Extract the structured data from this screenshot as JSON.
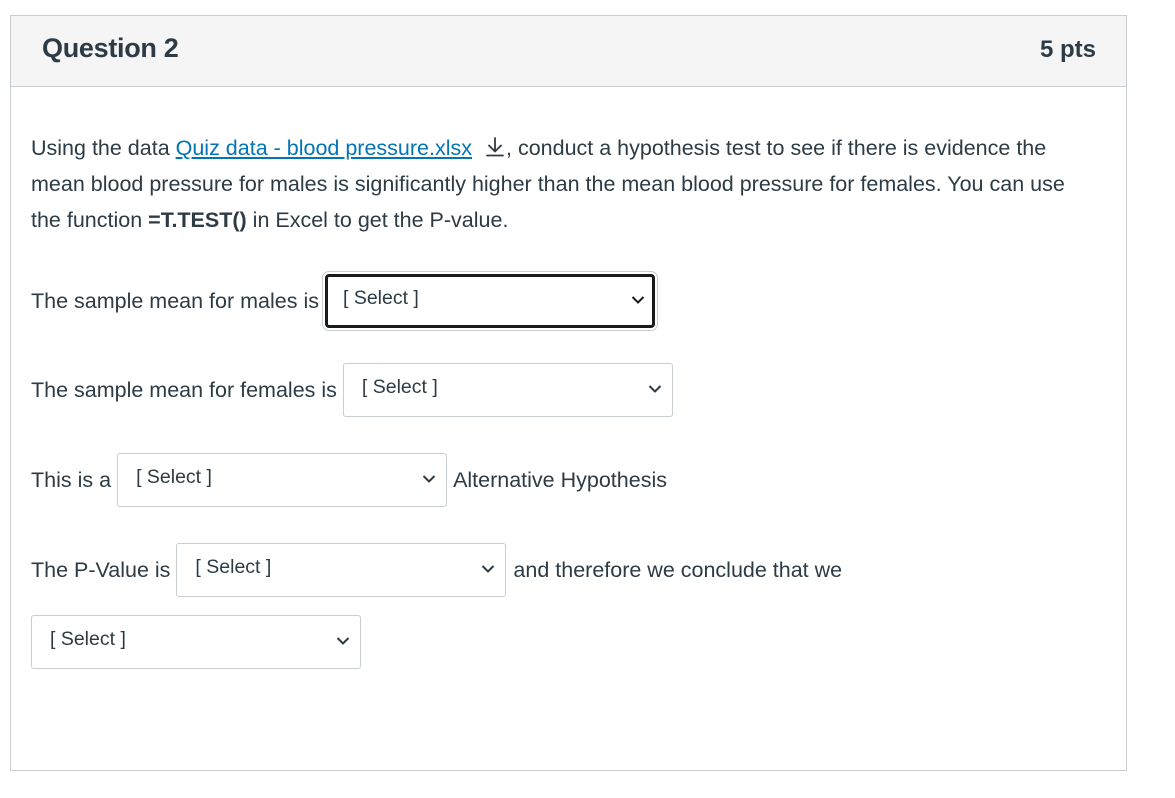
{
  "question": {
    "title": "Question 2",
    "points": "5 pts",
    "intro_before_link": "Using the data ",
    "link_text": "Quiz data - blood pressure.xlsx",
    "intro_after_link": ", conduct a hypothesis test to see if there is evidence the mean blood pressure for males is significantly higher than the mean blood pressure for females. You can use the function ",
    "function_text": "=T.TEST()",
    "intro_end": " in Excel to get the P-value."
  },
  "rows": {
    "males_label": "The sample mean for males is",
    "females_label": "The sample mean for females is",
    "alt_prefix": "This is a",
    "alt_suffix": "Alternative Hypothesis",
    "pvalue_prefix": "The P-Value is",
    "pvalue_suffix": "and therefore we conclude that we"
  },
  "selects": {
    "males": "[ Select ]",
    "females": "[ Select ]",
    "alternative": "[ Select ]",
    "pvalue": "[ Select ]",
    "conclusion": "[ Select ]"
  },
  "icons": {
    "download": "download-icon",
    "chevron": "chevron-down-icon"
  },
  "colors": {
    "link": "#0374b5",
    "text": "#2d3b45",
    "border": "#c7cdd1",
    "header_bg": "#f5f5f5"
  }
}
